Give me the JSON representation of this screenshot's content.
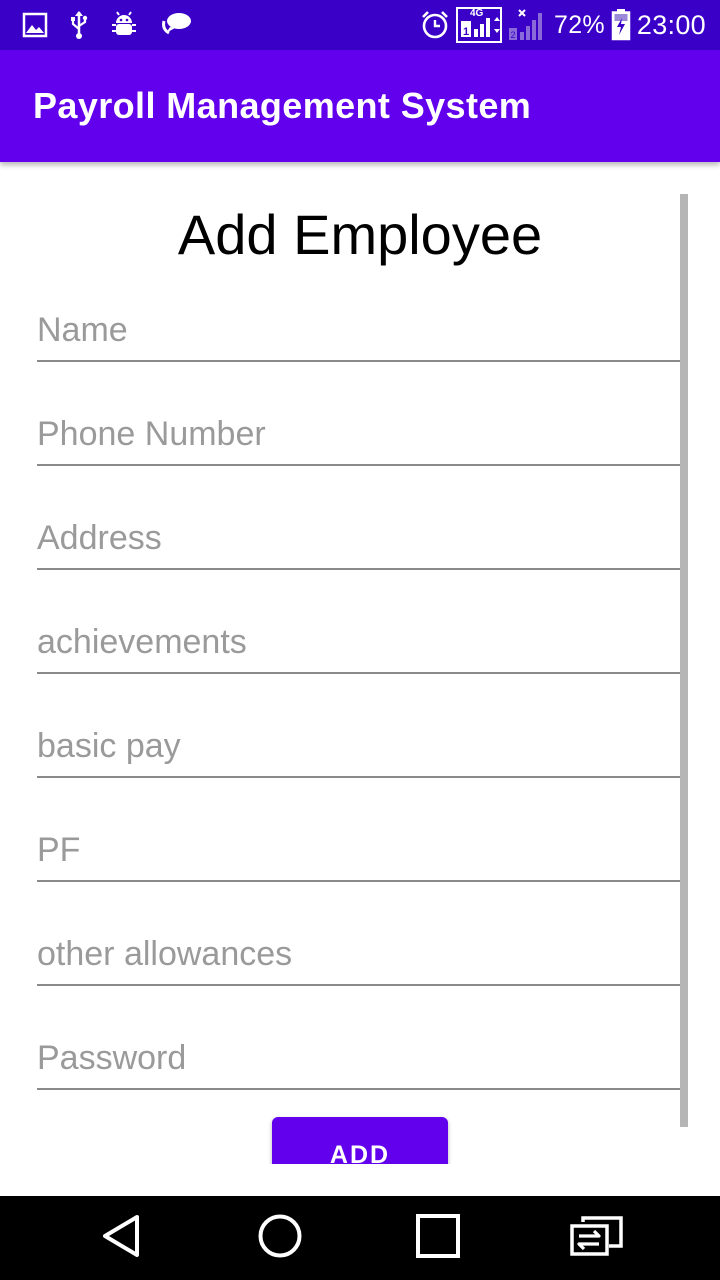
{
  "status_bar": {
    "icons_left": [
      "image-icon",
      "usb-icon",
      "android-debug-icon",
      "chat-bubble-icon"
    ],
    "icons_right": [
      "alarm-icon",
      "signal-4g-sim1-icon",
      "signal-sim2-icon",
      "battery-icon"
    ],
    "network_label": "4G",
    "battery_percent": "72%",
    "time": "23:00"
  },
  "app_bar": {
    "title": "Payroll Management System",
    "color": "#6200ee"
  },
  "form": {
    "title": "Add Employee",
    "fields": [
      {
        "placeholder": "Name",
        "value": ""
      },
      {
        "placeholder": "Phone Number",
        "value": ""
      },
      {
        "placeholder": "Address",
        "value": ""
      },
      {
        "placeholder": "achievements",
        "value": ""
      },
      {
        "placeholder": "basic pay",
        "value": ""
      },
      {
        "placeholder": "PF",
        "value": ""
      },
      {
        "placeholder": "other allowances",
        "value": ""
      },
      {
        "placeholder": "Password",
        "value": ""
      }
    ],
    "submit_label": "ADD"
  },
  "nav_bar": {
    "buttons": [
      "back-icon",
      "home-icon",
      "recents-icon",
      "switch-sim-icon"
    ]
  }
}
